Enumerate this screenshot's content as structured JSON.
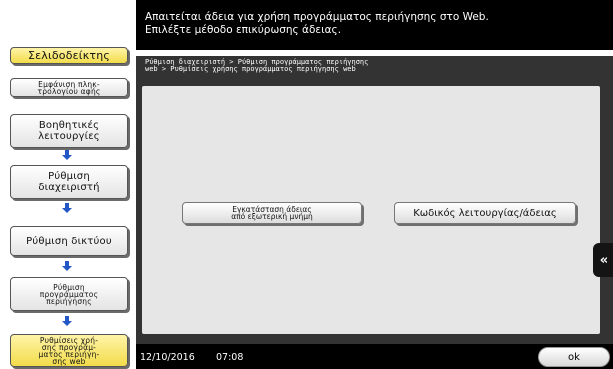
{
  "sidebar": {
    "bookmark": "Σελιδοδείκτης",
    "items": [
      {
        "line1": "Εμφάνιση πληκ-",
        "line2": "τρολογίου αφής"
      },
      {
        "line1": "Βοηθητικές",
        "line2": "λειτουργίες"
      },
      {
        "line1": "Ρύθμιση",
        "line2": "διαχειριστή"
      },
      {
        "line1": "Ρύθμιση δικτύου",
        "line2": ""
      },
      {
        "line1": "Ρύθμιση",
        "line2": "προγράμματος",
        "line3": "περιήγησης"
      },
      {
        "line1": "Ρυθμίσεις χρή-",
        "line2": "σης προγράμ-",
        "line3": "ματος περιήγη-",
        "line4": "σης web"
      }
    ]
  },
  "message": {
    "line1": "Απαιτείται άδεια για χρήση προγράμματος περιήγησης στο Web.",
    "line2": "Επιλέξτε μέθοδο επικύρωσης άδειας."
  },
  "breadcrumb": {
    "line1": "Ρύθμιση διαχειριστή > Ρύθμιση προγράμματος περιήγησης",
    "line2": "web > Ρυθμίσεις χρήσης προγράμματος περιήγησης web"
  },
  "options": {
    "install_line1": "Εγκατάσταση άδειας",
    "install_line2": "από εξωτερική μνήμη",
    "code": "Κωδικός λειτουργίας/άδειας"
  },
  "side_tab": {
    "label": "«"
  },
  "status": {
    "date": "12/10/2016",
    "time": "07:08",
    "ok": "ok"
  }
}
